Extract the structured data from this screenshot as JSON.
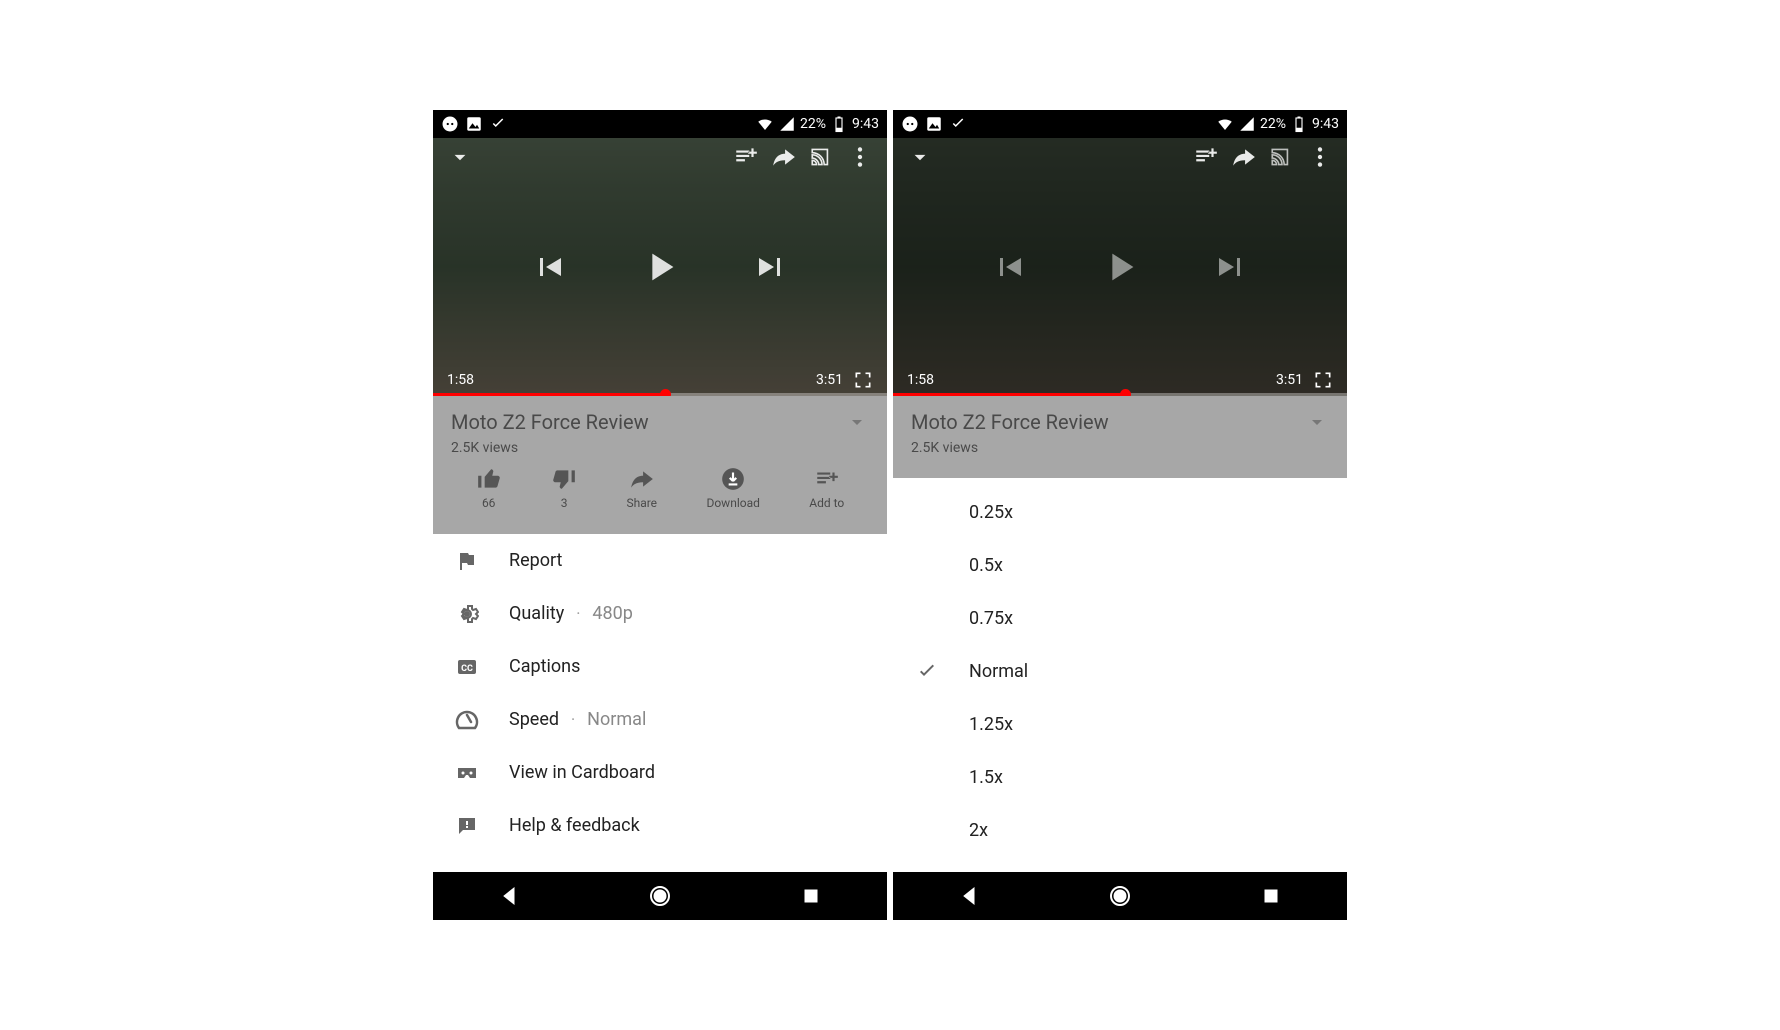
{
  "status_bar": {
    "battery": "22%",
    "time": "9:43"
  },
  "player": {
    "time_elapsed": "1:58",
    "time_total": "3:51"
  },
  "video": {
    "title": "Moto Z2 Force Review",
    "views": "2.5K views"
  },
  "actions": {
    "like_count": "66",
    "dislike_count": "3",
    "share": "Share",
    "download": "Download",
    "add_to": "Add to"
  },
  "menu": {
    "report": "Report",
    "quality": "Quality",
    "quality_value": "480p",
    "captions": "Captions",
    "speed": "Speed",
    "speed_value": "Normal",
    "cardboard": "View in Cardboard",
    "help": "Help & feedback",
    "dot": "·"
  },
  "speed_options": {
    "o1": "0.25x",
    "o2": "0.5x",
    "o3": "0.75x",
    "o4": "Normal",
    "o5": "1.25x",
    "o6": "1.5x",
    "o7": "2x"
  }
}
